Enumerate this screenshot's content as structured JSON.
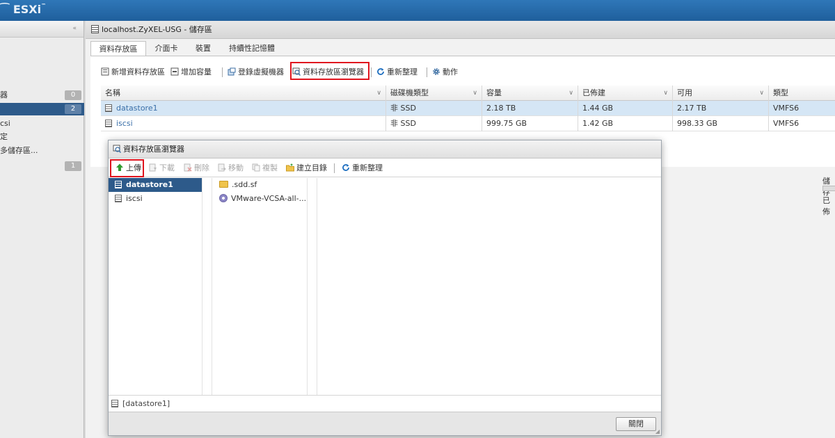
{
  "colors": {
    "header": "#1f5f9c",
    "selected": "#2d5a8a",
    "highlight": "#e0141e",
    "refresh": "#1e6fc0",
    "upload": "#2f9a2f"
  },
  "header": {
    "brand": "ESXi",
    "brand_mark": "™"
  },
  "sidebar": {
    "items": [
      {
        "label": "器",
        "badge": "0",
        "active": false
      },
      {
        "label": "",
        "badge": "2",
        "active": true
      },
      {
        "label": "csi",
        "badge": "",
        "active": false
      },
      {
        "label": "定",
        "badge": "",
        "active": false
      },
      {
        "label": "多儲存區...",
        "badge": "",
        "active": false
      },
      {
        "label": "",
        "badge": "1",
        "active": false
      }
    ]
  },
  "main": {
    "title": "localhost.ZyXEL-USG - 儲存區",
    "tabs": [
      "資料存放區",
      "介面卡",
      "裝置",
      "持續性記憶體"
    ],
    "toolbar": {
      "new_datastore": "新增資料存放區",
      "increase_capacity": "增加容量",
      "register_vm": "登錄虛擬機器",
      "datastore_browser": "資料存放區瀏覽器",
      "refresh": "重新整理",
      "actions": "動作"
    },
    "table": {
      "columns": [
        "名稱",
        "磁碟機類型",
        "容量",
        "已佈建",
        "可用",
        "類型"
      ],
      "rows": [
        [
          "datastore1",
          "非 SSD",
          "2.18 TB",
          "1.44 GB",
          "2.17 TB",
          "VMFS6"
        ],
        [
          "iscsi",
          "非 SSD",
          "999.75 GB",
          "1.42 GB",
          "998.33 GB",
          "VMFS6"
        ]
      ]
    },
    "right_labels": [
      "儲存",
      "已佈"
    ]
  },
  "dialog": {
    "title": "資料存放區瀏覽器",
    "toolbar": {
      "upload": "上傳",
      "download": "下載",
      "delete": "刪除",
      "move": "移動",
      "copy": "複製",
      "create_dir": "建立目錄",
      "refresh": "重新整理"
    },
    "datastores": [
      "datastore1",
      "iscsi"
    ],
    "files": [
      {
        "name": ".sdd.sf",
        "icon": "folder-icon"
      },
      {
        "name": "VMware-VCSA-all-...",
        "icon": "disc-image-icon"
      }
    ],
    "grip": "|||",
    "status_path": "[datastore1]",
    "close_label": "關閉"
  }
}
